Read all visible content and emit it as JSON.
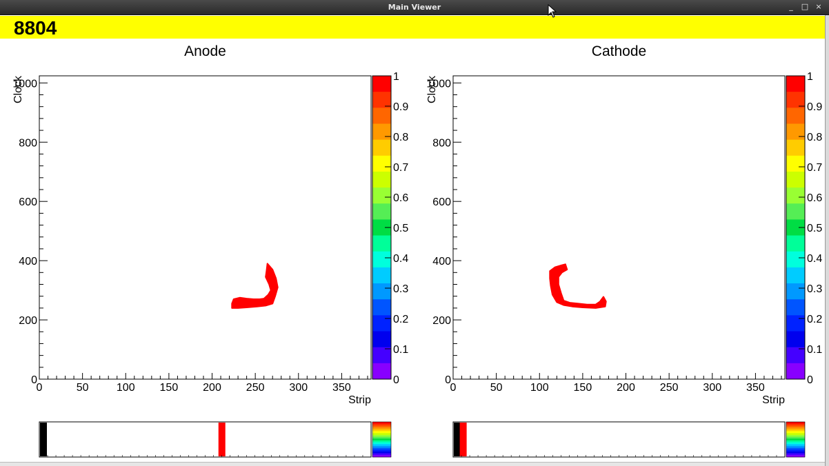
{
  "window": {
    "title": "Main Viewer",
    "minimize": "_",
    "maximize": "□",
    "close": "×"
  },
  "event_number": "8804",
  "color_scale": {
    "labels": [
      "1",
      "0.9",
      "0.8",
      "0.7",
      "0.6",
      "0.5",
      "0.4",
      "0.3",
      "0.2",
      "0.1",
      "0"
    ],
    "colors": [
      "#ff0000",
      "#ff3300",
      "#ff6600",
      "#ff9900",
      "#ffcc00",
      "#ffff00",
      "#ccff00",
      "#99ff33",
      "#55ee55",
      "#00dd44",
      "#00ff99",
      "#00ffdd",
      "#00ccff",
      "#0099ff",
      "#0055ff",
      "#0022ff",
      "#0000ee",
      "#4400ff",
      "#8800ff"
    ]
  },
  "chart_data": [
    {
      "type": "heatmap",
      "title": "Anode",
      "xlabel": "Strip",
      "ylabel": "Clock",
      "xlim": [
        0,
        384
      ],
      "ylim": [
        0,
        1024
      ],
      "xticks": [
        "0",
        "50",
        "100",
        "150",
        "200",
        "250",
        "300",
        "350"
      ],
      "yticks": [
        "0",
        "200",
        "400",
        "600",
        "800",
        "1000"
      ],
      "series": [
        {
          "points": [
            [
              223,
              240
            ],
            [
              223,
              255
            ],
            [
              225,
              270
            ],
            [
              232,
              275
            ],
            [
              240,
              272
            ],
            [
              248,
              270
            ],
            [
              255,
              270
            ],
            [
              260,
              272
            ],
            [
              265,
              285
            ],
            [
              268,
              300
            ],
            [
              266,
              320
            ],
            [
              262,
              345
            ],
            [
              263,
              365
            ],
            [
              264,
              390
            ],
            [
              270,
              370
            ],
            [
              274,
              340
            ],
            [
              276,
              310
            ],
            [
              273,
              280
            ],
            [
              270,
              255
            ],
            [
              262,
              248
            ],
            [
              252,
              245
            ],
            [
              240,
              242
            ],
            [
              230,
              240
            ]
          ]
        }
      ]
    },
    {
      "type": "heatmap",
      "title": "Cathode",
      "xlabel": "Strip",
      "ylabel": "Clock",
      "xlim": [
        0,
        384
      ],
      "ylim": [
        0,
        1024
      ],
      "xticks": [
        "0",
        "50",
        "100",
        "150",
        "200",
        "250",
        "300",
        "350"
      ],
      "yticks": [
        "0",
        "200",
        "400",
        "600",
        "800",
        "1000"
      ],
      "series": [
        {
          "points": [
            [
              112,
              340
            ],
            [
              112,
              365
            ],
            [
              118,
              378
            ],
            [
              126,
              385
            ],
            [
              130,
              388
            ],
            [
              132,
              370
            ],
            [
              126,
              360
            ],
            [
              122,
              345
            ],
            [
              122,
              320
            ],
            [
              125,
              290
            ],
            [
              128,
              265
            ],
            [
              135,
              258
            ],
            [
              145,
              255
            ],
            [
              155,
              252
            ],
            [
              165,
              252
            ],
            [
              170,
              262
            ],
            [
              174,
              278
            ],
            [
              177,
              262
            ],
            [
              176,
              245
            ],
            [
              165,
              240
            ],
            [
              150,
              242
            ],
            [
              138,
              245
            ],
            [
              128,
              250
            ],
            [
              120,
              260
            ],
            [
              115,
              285
            ],
            [
              113,
              315
            ]
          ]
        }
      ]
    },
    {
      "type": "heatmap",
      "title": "",
      "series": [
        {
          "band_x": 0.54
        }
      ]
    },
    {
      "type": "heatmap",
      "title": "",
      "series": [
        {
          "band_x": 0.02
        }
      ]
    }
  ]
}
